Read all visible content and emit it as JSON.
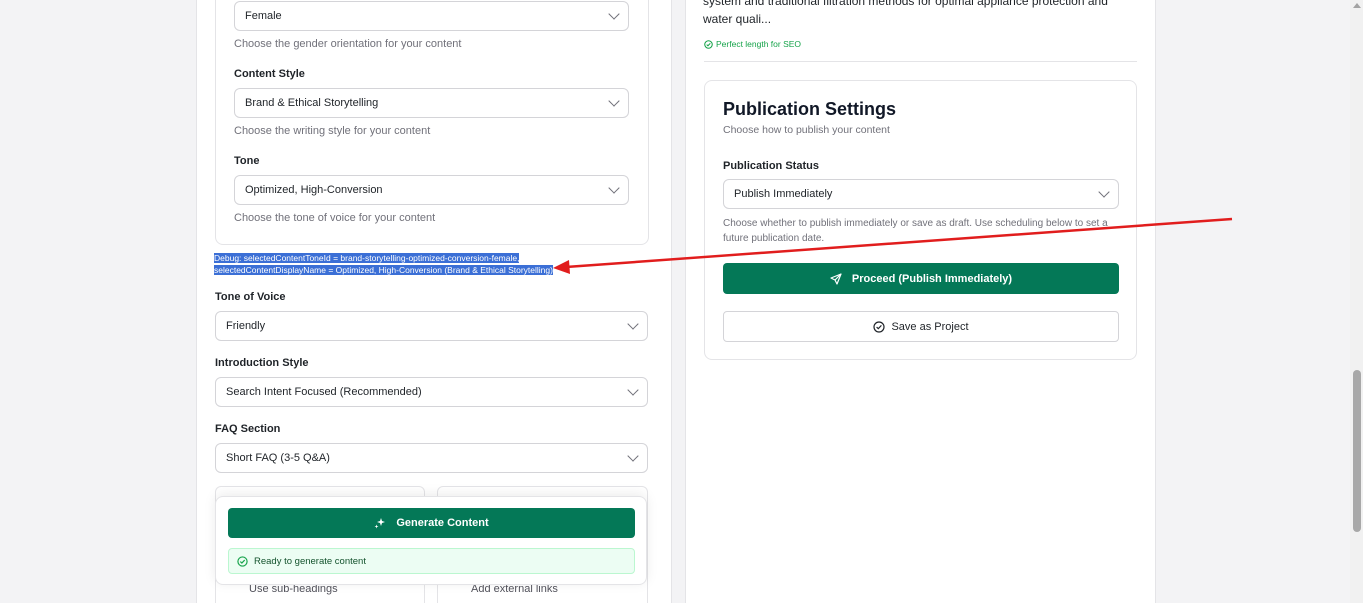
{
  "left": {
    "gender": {
      "value": "Female",
      "help": "Choose the gender orientation for your content"
    },
    "content_style": {
      "label": "Content Style",
      "value": "Brand & Ethical Storytelling",
      "help": "Choose the writing style for your content"
    },
    "tone": {
      "label": "Tone",
      "value": "Optimized, High-Conversion",
      "help": "Choose the tone of voice for your content"
    },
    "debug_text": "Debug: selectedContentToneId = brand-storytelling-optimized-conversion-female, selectedContentDisplayName = Optimized, High-Conversion (Brand & Ethical Storytelling)",
    "tone_of_voice": {
      "label": "Tone of Voice",
      "value": "Friendly"
    },
    "intro_style": {
      "label": "Introduction Style",
      "value": "Search Intent Focused (Recommended)"
    },
    "faq": {
      "label": "FAQ Section",
      "value": "Short FAQ (3-5 Q&A)"
    },
    "mini_cards": {
      "left_text": "Use sub-headings",
      "right_text": "Add external links"
    },
    "generate": {
      "button_label": "Generate Content",
      "status": "Ready to generate content"
    }
  },
  "right": {
    "description_text": "system and traditional filtration methods for optimal appliance protection and water quali...",
    "seo_status": "Perfect length for SEO",
    "publication": {
      "title": "Publication Settings",
      "subtitle": "Choose how to publish your content",
      "status_label": "Publication Status",
      "status_value": "Publish Immediately",
      "help": "Choose whether to publish immediately or save as draft. Use scheduling below to set a future publication date.",
      "proceed_label": "Proceed (Publish Immediately)",
      "save_label": "Save as Project"
    }
  },
  "colors": {
    "primary": "#047857",
    "annotation_arrow": "#e11d1d",
    "debug_highlight": "#3b6fd6"
  }
}
